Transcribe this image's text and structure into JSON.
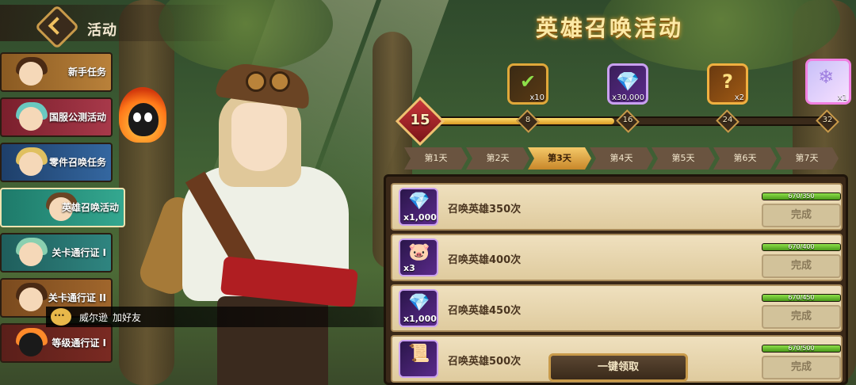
{
  "header": {
    "title": "活动"
  },
  "event": {
    "title": "英雄召唤活动"
  },
  "sidebar": {
    "items": [
      {
        "label": "新手任务",
        "color": "#a06a2a"
      },
      {
        "label": "国服公测活动",
        "color": "#8a2a3a"
      },
      {
        "label": "零件召唤任务",
        "color": "#2a5a8a"
      },
      {
        "label": "英雄召唤活动",
        "color": "#2a9a80",
        "selected": true
      },
      {
        "label": "关卡通行证 I",
        "color": "#276f6c"
      },
      {
        "label": "关卡通行证 II",
        "color": "#8a5a26"
      },
      {
        "label": "等级通行证 I",
        "color": "#6a2a22"
      }
    ]
  },
  "progress": {
    "current": "15",
    "fraction": 0.47,
    "milestones": [
      "8",
      "16",
      "24",
      "32"
    ]
  },
  "rewards": [
    {
      "icon": "checkmark-token-icon",
      "glyph": "✔",
      "count": "x10",
      "style": "gold"
    },
    {
      "icon": "diamond-icon",
      "glyph": "💎",
      "count": "x30,000",
      "style": "purple"
    },
    {
      "icon": "mystery-box-icon",
      "glyph": "?",
      "count": "x2",
      "style": "orange"
    },
    {
      "icon": "crystal-icon",
      "glyph": "❄",
      "count": "x1",
      "style": "pink"
    }
  ],
  "days": {
    "tabs": [
      "第1天",
      "第2天",
      "第3天",
      "第4天",
      "第5天",
      "第6天",
      "第7天"
    ],
    "active_index": 2
  },
  "tasks": [
    {
      "label": "召唤英雄350次",
      "qty": "x1,000",
      "glyph": "💎",
      "progress_text": "670/350",
      "fraction": 1.0,
      "button": "完成"
    },
    {
      "label": "召唤英雄400次",
      "qty": "x3",
      "glyph": "🐷",
      "progress_text": "670/400",
      "fraction": 1.0,
      "button": "完成"
    },
    {
      "label": "召唤英雄450次",
      "qty": "x1,000",
      "glyph": "💎",
      "progress_text": "670/450",
      "fraction": 1.0,
      "button": "完成"
    },
    {
      "label": "召唤英雄500次",
      "qty": "",
      "glyph": "📜",
      "progress_text": "670/500",
      "fraction": 1.0,
      "button": "完成"
    }
  ],
  "claim_all": {
    "label": "一键领取"
  },
  "chat": {
    "name": "威尔逊",
    "action": "加好友",
    "icon": "chat-bubble-icon"
  },
  "colors": {
    "accent": "#f4c868",
    "title": "#fce9a6",
    "panel": "#efe0be"
  }
}
